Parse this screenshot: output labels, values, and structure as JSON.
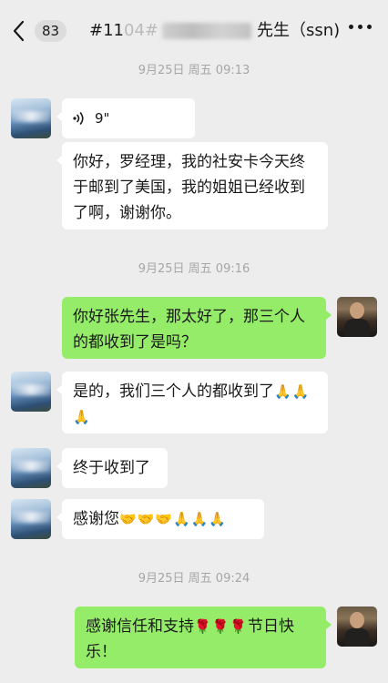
{
  "header": {
    "back_count": "83",
    "title_prefix": "#11",
    "title_mid": "04#",
    "title_suffix": "先生（ssn)"
  },
  "messages": {
    "ts1": "9月25日 周五 09:13",
    "voice_duration": "9\"",
    "msg1": "你好，罗经理，我的社安卡今天终于邮到了美国，我的姐姐已经收到了啊，谢谢你。",
    "ts2": "9月25日 周五 09:16",
    "msg2": "你好张先生，那太好了，那三个人的都收到了是吗？",
    "msg3_text": "是的，我们三个人的都收到了",
    "msg3_emoji": "🙏🙏🙏",
    "msg4": "终于收到了",
    "msg5_text": "感谢您",
    "msg5_emoji": "🤝🤝🤝🙏🙏🙏",
    "ts3": "9月25日 周五 09:24",
    "msg6_text": "感谢信任和支持",
    "msg6_emoji": "🌹🌹🌹",
    "msg6_tail": "节日快乐！"
  }
}
